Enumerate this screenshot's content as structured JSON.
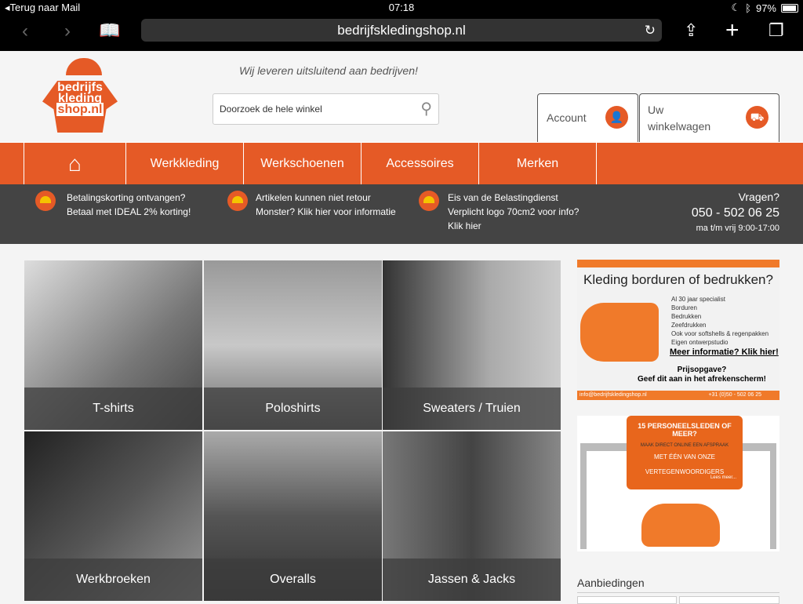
{
  "status": {
    "back": "Terug naar Mail",
    "time": "07:18",
    "battery": "97%",
    "battery_level": 0.97
  },
  "browser": {
    "url": "bedrijfskledingshop.nl"
  },
  "header": {
    "logo_text": [
      "bedrijfs",
      "kleding",
      "shop.nl"
    ],
    "tagline": "Wij leveren uitsluitend aan bedrijven!",
    "search_placeholder": "Doorzoek de hele winkel",
    "account": "Account",
    "cart": "Uw winkelwagen"
  },
  "nav": {
    "items": [
      "Werkkleding",
      "Werkschoenen",
      "Accessoires",
      "Merken"
    ]
  },
  "info": [
    {
      "title": "Betalingskorting ontvangen?",
      "text": "Betaal met IDEAL 2% korting!"
    },
    {
      "title": "Artikelen kunnen niet retour",
      "text": "Monster? Klik hier voor informatie"
    },
    {
      "title": "Eis van de Belastingdienst",
      "text": "Verplicht logo 70cm2 voor info?",
      "text2": "Klik hier"
    }
  ],
  "contact": {
    "q": "Vragen?",
    "phone": "050 - 502 06 25",
    "hours": "ma t/m vrij 9:00-17:00"
  },
  "categories": [
    "T-shirts",
    "Poloshirts",
    "Sweaters / Truien",
    "Werkbroeken",
    "Overalls",
    "Jassen & Jacks"
  ],
  "banner1": {
    "title": "Kleding borduren of bedrukken?",
    "bullets": [
      "Al 30 jaar specialist",
      "Borduren",
      "Bedrukken",
      "Zeefdrukken",
      "Ook voor softshells & regenpakken",
      "Eigen ontwerpstudio"
    ],
    "more": "Meer informatie? Klik hier!",
    "quote1": "Prijsopgave?",
    "quote2": "Geef dit aan in het afrekenscherm!",
    "email": "info@bedrijfskledingshop.nl",
    "phone": "+31 (0)50 - 502 06 25"
  },
  "banner2": {
    "title": "15 PERSONEELSLEDEN OF MEER?",
    "l1": "MAAK DIRECT ONLINE EEN AFSPRAAK",
    "l2": "MET ÉÉN VAN ONZE",
    "l3": "VERTEGENWOORDIGERS",
    "more": "Lees meer..."
  },
  "aanbiedingen": "Aanbiedingen",
  "colors": {
    "brand": "#e55a26",
    "dark": "#444444"
  }
}
